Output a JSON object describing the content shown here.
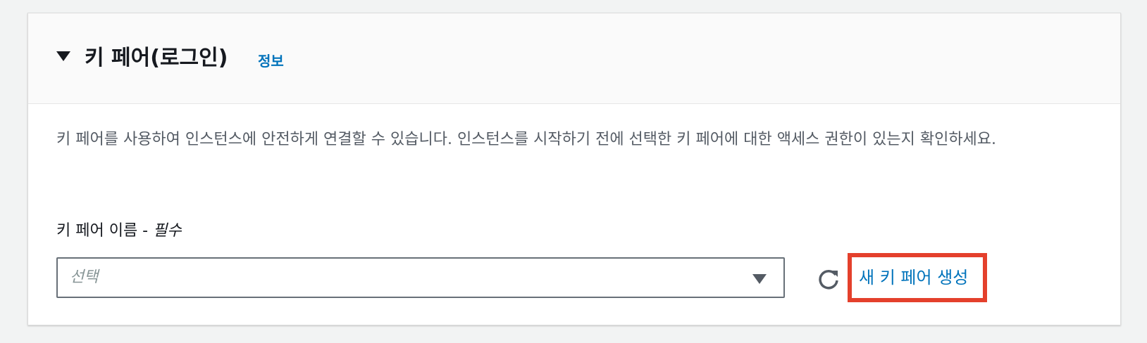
{
  "section": {
    "title": "키 페어(로그인)",
    "info_link": "정보",
    "description": "키 페어를 사용하여 인스턴스에 안전하게 연결할 수 있습니다. 인스턴스를 시작하기 전에 선택한 키 페어에 대한 액세스 권한이 있는지 확인하세요."
  },
  "key_pair_field": {
    "label": "키 페어 이름 - ",
    "required": "필수",
    "placeholder": "선택",
    "create_link": "새 키 페어 생성"
  },
  "icons": {
    "collapse": "caret-down-icon",
    "dropdown": "caret-down-icon",
    "refresh": "refresh-icon"
  },
  "colors": {
    "link": "#0073bb",
    "highlight": "#e4402c"
  }
}
